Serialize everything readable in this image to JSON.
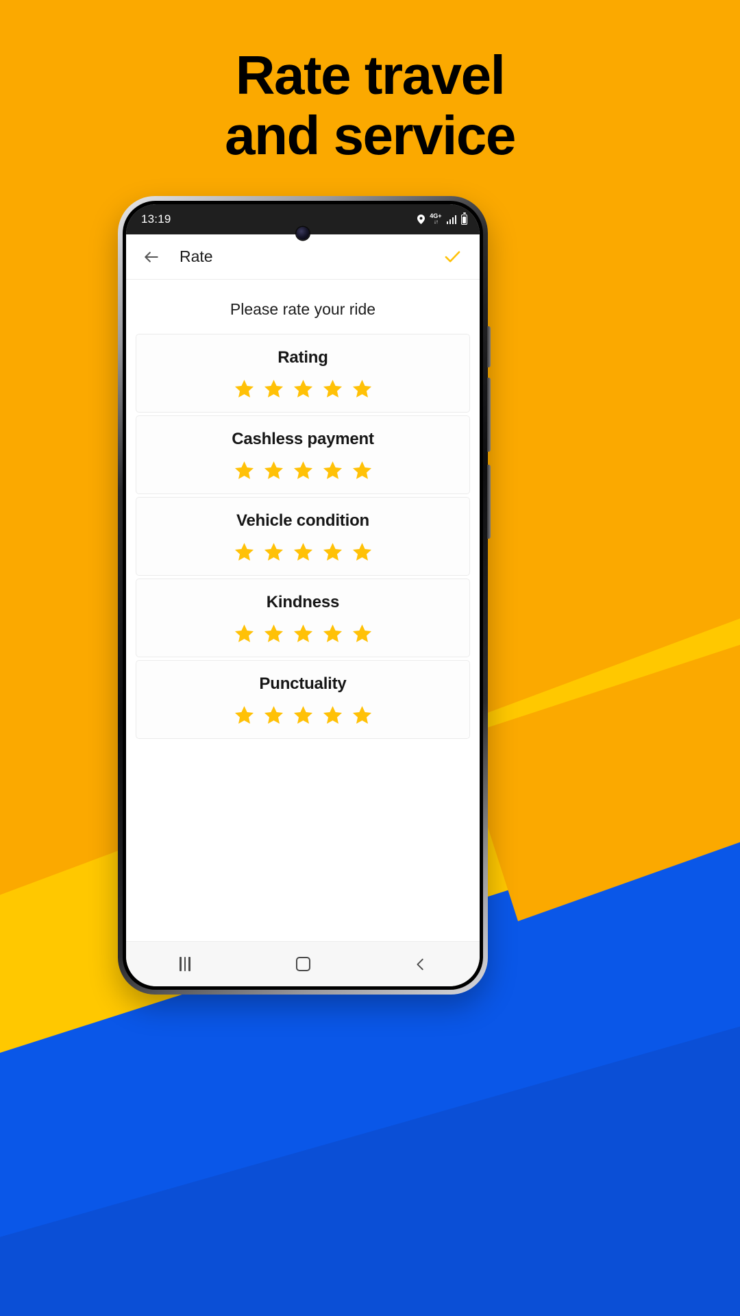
{
  "promo": {
    "headline_line1": "Rate travel",
    "headline_line2": "and service",
    "bg_orange": "#FBA900",
    "bg_yellow": "#FFC800",
    "bg_blue": "#0A57E8",
    "star_color": "#FFC107"
  },
  "status_bar": {
    "time": "13:19",
    "location_icon": "location-pin-icon",
    "network_label": "4G+",
    "network_arrows": "↓↑",
    "signal_icon": "signal-bars-icon",
    "battery_icon": "battery-icon"
  },
  "toolbar": {
    "back_icon": "arrow-left-icon",
    "title": "Rate",
    "confirm_icon": "check-icon"
  },
  "screen": {
    "prompt": "Please rate your ride",
    "cards": [
      {
        "title": "Rating",
        "rating": 5,
        "max": 5
      },
      {
        "title": "Cashless payment",
        "rating": 5,
        "max": 5
      },
      {
        "title": "Vehicle condition",
        "rating": 5,
        "max": 5
      },
      {
        "title": "Kindness",
        "rating": 5,
        "max": 5
      },
      {
        "title": "Punctuality",
        "rating": 5,
        "max": 5
      }
    ]
  },
  "nav_bar": {
    "recents_icon": "recents-icon",
    "home_icon": "home-icon",
    "back_icon": "back-chevron-icon"
  }
}
